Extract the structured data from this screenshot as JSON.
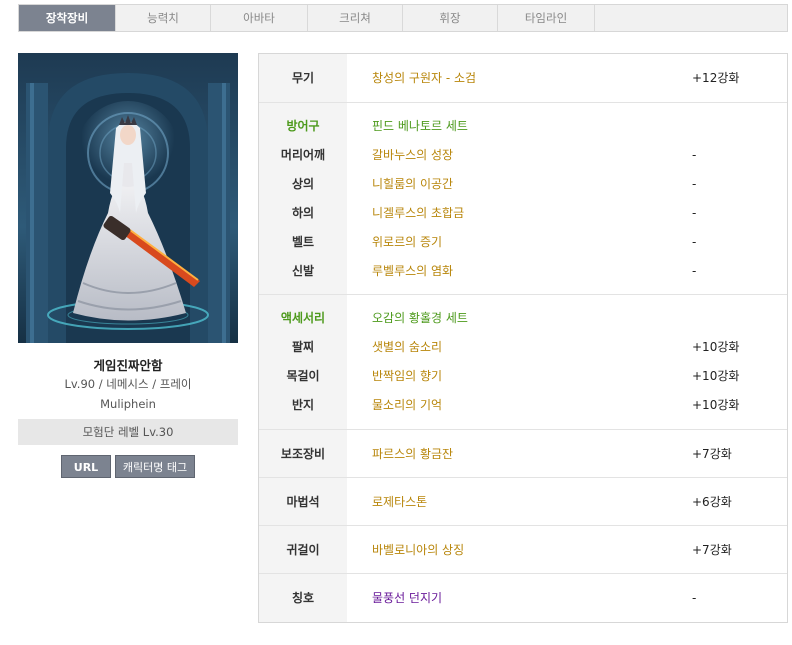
{
  "tabs": [
    {
      "label": "장착장비",
      "active": true
    },
    {
      "label": "능력치",
      "active": false
    },
    {
      "label": "아바타",
      "active": false
    },
    {
      "label": "크리쳐",
      "active": false
    },
    {
      "label": "휘장",
      "active": false
    },
    {
      "label": "타임라인",
      "active": false
    }
  ],
  "character": {
    "name": "게임진짜안함",
    "info": "Lv.90 / 네메시스 / 프레이",
    "server": "Muliphein",
    "adventure_level": "모험단 레벨 Lv.30",
    "url_button": "URL",
    "tag_button": "캐릭터명 태그"
  },
  "equipment": {
    "weapon": {
      "slot": "무기",
      "item": "창성의 구원자 - 소검",
      "enhance": "+12강화"
    },
    "armor_set": {
      "slot": "방어구",
      "set_name": "핀드 베나토르 세트"
    },
    "armor": [
      {
        "slot": "머리어깨",
        "item": "갈바누스의 성장",
        "enhance": "-"
      },
      {
        "slot": "상의",
        "item": "니힐룸의 이공간",
        "enhance": "-"
      },
      {
        "slot": "하의",
        "item": "니겔루스의 초합금",
        "enhance": "-"
      },
      {
        "slot": "벨트",
        "item": "위로르의 증기",
        "enhance": "-"
      },
      {
        "slot": "신발",
        "item": "루벨루스의 염화",
        "enhance": "-"
      }
    ],
    "accessory_set": {
      "slot": "액세서리",
      "set_name": "오감의 황홀경 세트"
    },
    "accessories": [
      {
        "slot": "팔찌",
        "item": "샛별의 숨소리",
        "enhance": "+10강화"
      },
      {
        "slot": "목걸이",
        "item": "반짝임의 향기",
        "enhance": "+10강화"
      },
      {
        "slot": "반지",
        "item": "물소리의 기억",
        "enhance": "+10강화"
      }
    ],
    "subweapon": {
      "slot": "보조장비",
      "item": "파르스의 황금잔",
      "enhance": "+7강화"
    },
    "magicstone": {
      "slot": "마법석",
      "item": "로제타스톤",
      "enhance": "+6강화"
    },
    "earring": {
      "slot": "귀걸이",
      "item": "바벨로니아의 상징",
      "enhance": "+7강화"
    },
    "title": {
      "slot": "칭호",
      "item": "물풍선 던지기",
      "enhance": "-"
    }
  }
}
